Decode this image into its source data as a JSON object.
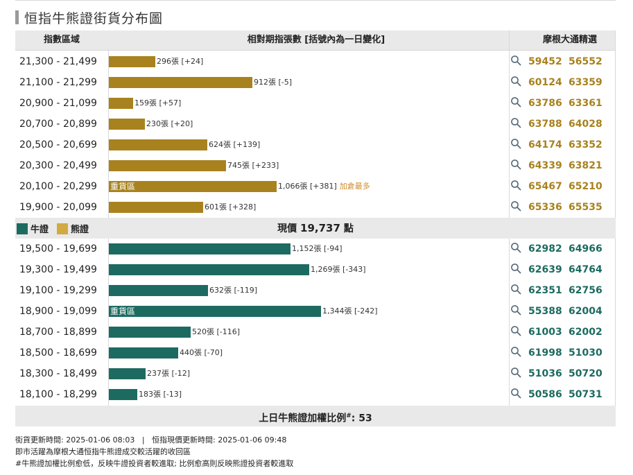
{
  "title": "恒指牛熊證街貨分布圖",
  "header": {
    "range": "指數區域",
    "bars": "相對期指張數 [括號內為一日變化]",
    "warrants": "摩根大通精選"
  },
  "colors": {
    "bear": "#a8821e",
    "bull": "#1d6b60",
    "bear_legend": "#d1aa44",
    "hot": "#d08a2a"
  },
  "bear_rows": [
    {
      "range": "21,300 - 21,499",
      "label": "296張 [+24]",
      "tag": "",
      "note": "",
      "codes": [
        "59452",
        "56552"
      ]
    },
    {
      "range": "21,100 - 21,299",
      "label": "912張 [-5]",
      "tag": "",
      "note": "",
      "codes": [
        "60124",
        "63359"
      ]
    },
    {
      "range": "20,900 - 21,099",
      "label": "159張 [+57]",
      "tag": "",
      "note": "",
      "codes": [
        "63786",
        "63361"
      ]
    },
    {
      "range": "20,700 - 20,899",
      "label": "230張 [+20]",
      "tag": "",
      "note": "",
      "codes": [
        "63788",
        "64028"
      ]
    },
    {
      "range": "20,500 - 20,699",
      "label": "624張 [+139]",
      "tag": "",
      "note": "",
      "codes": [
        "64174",
        "63352"
      ]
    },
    {
      "range": "20,300 - 20,499",
      "label": "745張 [+233]",
      "tag": "",
      "note": "",
      "codes": [
        "64339",
        "63821"
      ]
    },
    {
      "range": "20,100 - 20,299",
      "label": "1,066張 [+381]",
      "tag": "重貨區",
      "note": "加倉最多",
      "codes": [
        "65467",
        "65210"
      ]
    },
    {
      "range": "19,900 - 20,099",
      "label": "601張 [+328]",
      "tag": "",
      "note": "",
      "codes": [
        "65336",
        "65535"
      ]
    }
  ],
  "bull_rows": [
    {
      "range": "19,500 - 19,699",
      "label": "1,152張 [-94]",
      "tag": "",
      "note": "",
      "codes": [
        "62982",
        "64966"
      ]
    },
    {
      "range": "19,300 - 19,499",
      "label": "1,269張 [-343]",
      "tag": "",
      "note": "",
      "codes": [
        "62639",
        "64764"
      ]
    },
    {
      "range": "19,100 - 19,299",
      "label": "632張 [-119]",
      "tag": "",
      "note": "",
      "codes": [
        "62351",
        "62756"
      ]
    },
    {
      "range": "18,900 - 19,099",
      "label": "1,344張 [-242]",
      "tag": "重貨區",
      "note": "",
      "codes": [
        "55388",
        "62004"
      ]
    },
    {
      "range": "18,700 - 18,899",
      "label": "520張 [-116]",
      "tag": "",
      "note": "",
      "codes": [
        "61003",
        "62002"
      ]
    },
    {
      "range": "18,500 - 18,699",
      "label": "440張 [-70]",
      "tag": "",
      "note": "",
      "codes": [
        "61998",
        "51030"
      ]
    },
    {
      "range": "18,300 - 18,499",
      "label": "237張 [-12]",
      "tag": "",
      "note": "",
      "codes": [
        "51036",
        "50720"
      ]
    },
    {
      "range": "18,100 - 18,299",
      "label": "183張 [-13]",
      "tag": "",
      "note": "",
      "codes": [
        "50586",
        "50731"
      ]
    }
  ],
  "legend": {
    "bull": "牛證",
    "bear": "熊證"
  },
  "price": {
    "label": "現價",
    "value": "19,737",
    "unit": "點"
  },
  "ratio": {
    "label": "上日牛熊證加權比例",
    "sup": "#",
    "colon": ":",
    "value": "53"
  },
  "notes": {
    "line1": "街貨更新時間: 2025-01-06 08:03   |   恒指現價更新時間: 2025-01-06 09:48",
    "line2": "即市活躍為摩根大通恒指牛熊證成交較活躍的收回區",
    "line3": "#牛熊證加權比例愈低，反映牛證投資者較進取; 比例愈高則反映熊證投資者較進取"
  },
  "chart_data": {
    "type": "bar",
    "title": "恒指牛熊證街貨分布圖",
    "orientation": "horizontal",
    "categories": [
      "21,300 - 21,499",
      "21,100 - 21,299",
      "20,900 - 21,099",
      "20,700 - 20,899",
      "20,500 - 20,699",
      "20,300 - 20,499",
      "20,100 - 20,299",
      "19,900 - 20,099",
      "19,500 - 19,699",
      "19,300 - 19,499",
      "19,100 - 19,299",
      "18,900 - 19,099",
      "18,700 - 18,899",
      "18,500 - 18,699",
      "18,300 - 18,499",
      "18,100 - 18,299"
    ],
    "series": [
      {
        "name": "熊證",
        "values": [
          296,
          912,
          159,
          230,
          624,
          745,
          1066,
          601,
          null,
          null,
          null,
          null,
          null,
          null,
          null,
          null
        ],
        "changes": [
          24,
          -5,
          57,
          20,
          139,
          233,
          381,
          328,
          null,
          null,
          null,
          null,
          null,
          null,
          null,
          null
        ]
      },
      {
        "name": "牛證",
        "values": [
          null,
          null,
          null,
          null,
          null,
          null,
          null,
          null,
          1152,
          1269,
          632,
          1344,
          520,
          440,
          237,
          183
        ],
        "changes": [
          null,
          null,
          null,
          null,
          null,
          null,
          null,
          null,
          -94,
          -343,
          -119,
          -242,
          -116,
          -70,
          -12,
          -13
        ]
      }
    ],
    "current_price": 19737,
    "xlim": [
      0,
      1344
    ]
  }
}
